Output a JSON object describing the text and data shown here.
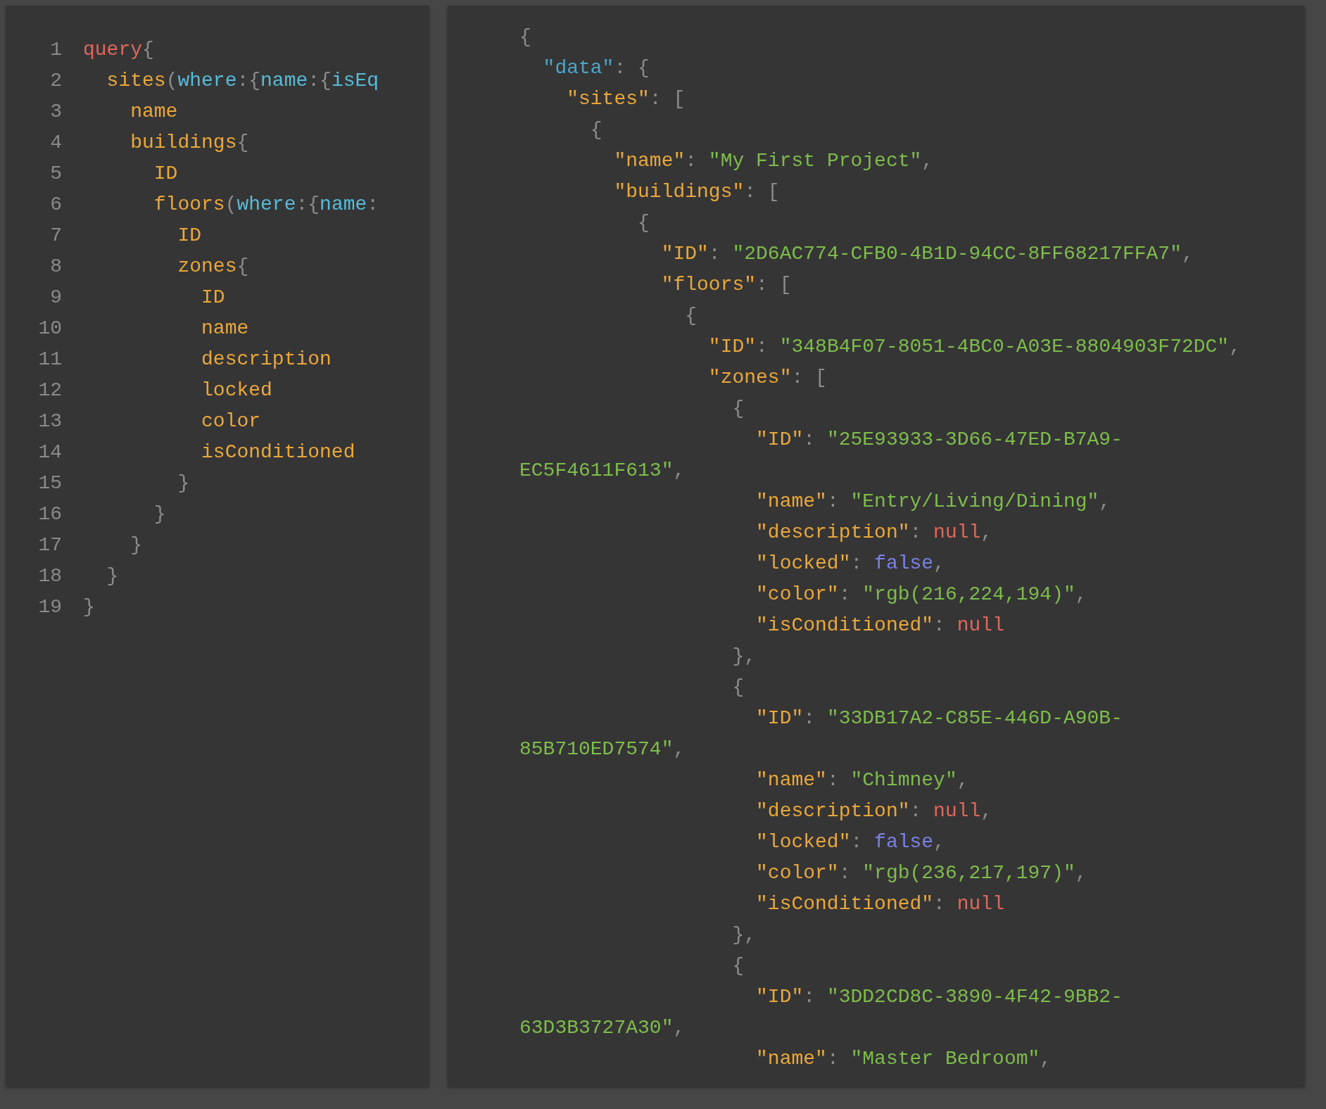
{
  "query_editor": {
    "lines": [
      {
        "number": "1",
        "tokens": [
          {
            "kind": "keyword",
            "text": "query"
          },
          {
            "kind": "punct",
            "text": "{"
          }
        ]
      },
      {
        "number": "2",
        "tokens": [
          {
            "kind": "field",
            "text": "  sites"
          },
          {
            "kind": "punct",
            "text": "("
          },
          {
            "kind": "arg",
            "text": "where"
          },
          {
            "kind": "punct",
            "text": ":{"
          },
          {
            "kind": "arg",
            "text": "name"
          },
          {
            "kind": "punct",
            "text": ":{"
          },
          {
            "kind": "arg",
            "text": "isEq"
          }
        ]
      },
      {
        "number": "3",
        "tokens": [
          {
            "kind": "field",
            "text": "    name"
          }
        ]
      },
      {
        "number": "4",
        "tokens": [
          {
            "kind": "field",
            "text": "    buildings"
          },
          {
            "kind": "punct",
            "text": "{"
          }
        ]
      },
      {
        "number": "5",
        "tokens": [
          {
            "kind": "field",
            "text": "      ID"
          }
        ]
      },
      {
        "number": "6",
        "tokens": [
          {
            "kind": "field",
            "text": "      floors"
          },
          {
            "kind": "punct",
            "text": "("
          },
          {
            "kind": "arg",
            "text": "where"
          },
          {
            "kind": "punct",
            "text": ":{"
          },
          {
            "kind": "arg",
            "text": "name"
          },
          {
            "kind": "punct",
            "text": ":"
          }
        ]
      },
      {
        "number": "7",
        "tokens": [
          {
            "kind": "field",
            "text": "        ID"
          }
        ]
      },
      {
        "number": "8",
        "tokens": [
          {
            "kind": "field",
            "text": "        zones"
          },
          {
            "kind": "punct",
            "text": "{"
          }
        ]
      },
      {
        "number": "9",
        "tokens": [
          {
            "kind": "field",
            "text": "          ID"
          }
        ]
      },
      {
        "number": "10",
        "tokens": [
          {
            "kind": "field",
            "text": "          name"
          }
        ]
      },
      {
        "number": "11",
        "tokens": [
          {
            "kind": "field",
            "text": "          description"
          }
        ]
      },
      {
        "number": "12",
        "tokens": [
          {
            "kind": "field",
            "text": "          locked"
          }
        ]
      },
      {
        "number": "13",
        "tokens": [
          {
            "kind": "field",
            "text": "          color"
          }
        ]
      },
      {
        "number": "14",
        "tokens": [
          {
            "kind": "field",
            "text": "          isConditioned"
          }
        ]
      },
      {
        "number": "15",
        "tokens": [
          {
            "kind": "punct",
            "text": "        }"
          }
        ]
      },
      {
        "number": "16",
        "tokens": [
          {
            "kind": "punct",
            "text": "      }"
          }
        ]
      },
      {
        "number": "17",
        "tokens": [
          {
            "kind": "punct",
            "text": "    }"
          }
        ]
      },
      {
        "number": "18",
        "tokens": [
          {
            "kind": "punct",
            "text": "  }"
          }
        ]
      },
      {
        "number": "19",
        "tokens": [
          {
            "kind": "punct",
            "text": "}"
          }
        ]
      }
    ]
  },
  "result_viewer": {
    "lines": [
      [
        {
          "kind": "punct",
          "text": "{"
        }
      ],
      [
        {
          "kind": "datakey",
          "text": "  \"data\""
        },
        {
          "kind": "punct",
          "text": ": {"
        }
      ],
      [
        {
          "kind": "field",
          "text": "    \"sites\""
        },
        {
          "kind": "punct",
          "text": ": ["
        }
      ],
      [
        {
          "kind": "punct",
          "text": "      {"
        }
      ],
      [
        {
          "kind": "field",
          "text": "        \"name\""
        },
        {
          "kind": "punct",
          "text": ": "
        },
        {
          "kind": "string",
          "text": "\"My First Project\""
        },
        {
          "kind": "punct",
          "text": ","
        }
      ],
      [
        {
          "kind": "field",
          "text": "        \"buildings\""
        },
        {
          "kind": "punct",
          "text": ": ["
        }
      ],
      [
        {
          "kind": "punct",
          "text": "          {"
        }
      ],
      [
        {
          "kind": "field",
          "text": "            \"ID\""
        },
        {
          "kind": "punct",
          "text": ": "
        },
        {
          "kind": "string",
          "text": "\"2D6AC774-CFB0-4B1D-94CC-8FF68217FFA7\""
        },
        {
          "kind": "punct",
          "text": ","
        }
      ],
      [
        {
          "kind": "field",
          "text": "            \"floors\""
        },
        {
          "kind": "punct",
          "text": ": ["
        }
      ],
      [
        {
          "kind": "punct",
          "text": "              {"
        }
      ],
      [
        {
          "kind": "field",
          "text": "                \"ID\""
        },
        {
          "kind": "punct",
          "text": ": "
        },
        {
          "kind": "string",
          "text": "\"348B4F07-8051-4BC0-A03E-8804903F72DC\""
        },
        {
          "kind": "punct",
          "text": ","
        }
      ],
      [
        {
          "kind": "field",
          "text": "                \"zones\""
        },
        {
          "kind": "punct",
          "text": ": ["
        }
      ],
      [
        {
          "kind": "punct",
          "text": "                  {"
        }
      ],
      [
        {
          "kind": "field",
          "text": "                    \"ID\""
        },
        {
          "kind": "punct",
          "text": ": "
        },
        {
          "kind": "string",
          "text": "\"25E93933-3D66-47ED-B7A9-"
        }
      ],
      [
        {
          "kind": "string",
          "text": "EC5F4611F613\""
        },
        {
          "kind": "punct",
          "text": ","
        }
      ],
      [
        {
          "kind": "field",
          "text": "                    \"name\""
        },
        {
          "kind": "punct",
          "text": ": "
        },
        {
          "kind": "string",
          "text": "\"Entry/Living/Dining\""
        },
        {
          "kind": "punct",
          "text": ","
        }
      ],
      [
        {
          "kind": "field",
          "text": "                    \"description\""
        },
        {
          "kind": "punct",
          "text": ": "
        },
        {
          "kind": "null",
          "text": "null"
        },
        {
          "kind": "punct",
          "text": ","
        }
      ],
      [
        {
          "kind": "field",
          "text": "                    \"locked\""
        },
        {
          "kind": "punct",
          "text": ": "
        },
        {
          "kind": "bool",
          "text": "false"
        },
        {
          "kind": "punct",
          "text": ","
        }
      ],
      [
        {
          "kind": "field",
          "text": "                    \"color\""
        },
        {
          "kind": "punct",
          "text": ": "
        },
        {
          "kind": "string",
          "text": "\"rgb(216,224,194)\""
        },
        {
          "kind": "punct",
          "text": ","
        }
      ],
      [
        {
          "kind": "field",
          "text": "                    \"isConditioned\""
        },
        {
          "kind": "punct",
          "text": ": "
        },
        {
          "kind": "null",
          "text": "null"
        }
      ],
      [
        {
          "kind": "punct",
          "text": "                  },"
        }
      ],
      [
        {
          "kind": "punct",
          "text": "                  {"
        }
      ],
      [
        {
          "kind": "field",
          "text": "                    \"ID\""
        },
        {
          "kind": "punct",
          "text": ": "
        },
        {
          "kind": "string",
          "text": "\"33DB17A2-C85E-446D-A90B-"
        }
      ],
      [
        {
          "kind": "string",
          "text": "85B710ED7574\""
        },
        {
          "kind": "punct",
          "text": ","
        }
      ],
      [
        {
          "kind": "field",
          "text": "                    \"name\""
        },
        {
          "kind": "punct",
          "text": ": "
        },
        {
          "kind": "string",
          "text": "\"Chimney\""
        },
        {
          "kind": "punct",
          "text": ","
        }
      ],
      [
        {
          "kind": "field",
          "text": "                    \"description\""
        },
        {
          "kind": "punct",
          "text": ": "
        },
        {
          "kind": "null",
          "text": "null"
        },
        {
          "kind": "punct",
          "text": ","
        }
      ],
      [
        {
          "kind": "field",
          "text": "                    \"locked\""
        },
        {
          "kind": "punct",
          "text": ": "
        },
        {
          "kind": "bool",
          "text": "false"
        },
        {
          "kind": "punct",
          "text": ","
        }
      ],
      [
        {
          "kind": "field",
          "text": "                    \"color\""
        },
        {
          "kind": "punct",
          "text": ": "
        },
        {
          "kind": "string",
          "text": "\"rgb(236,217,197)\""
        },
        {
          "kind": "punct",
          "text": ","
        }
      ],
      [
        {
          "kind": "field",
          "text": "                    \"isConditioned\""
        },
        {
          "kind": "punct",
          "text": ": "
        },
        {
          "kind": "null",
          "text": "null"
        }
      ],
      [
        {
          "kind": "punct",
          "text": "                  },"
        }
      ],
      [
        {
          "kind": "punct",
          "text": "                  {"
        }
      ],
      [
        {
          "kind": "field",
          "text": "                    \"ID\""
        },
        {
          "kind": "punct",
          "text": ": "
        },
        {
          "kind": "string",
          "text": "\"3DD2CD8C-3890-4F42-9BB2-"
        }
      ],
      [
        {
          "kind": "string",
          "text": "63D3B3727A30\""
        },
        {
          "kind": "punct",
          "text": ","
        }
      ],
      [
        {
          "kind": "field",
          "text": "                    \"name\""
        },
        {
          "kind": "punct",
          "text": ": "
        },
        {
          "kind": "string",
          "text": "\"Master Bedroom\""
        },
        {
          "kind": "punct",
          "text": ","
        }
      ]
    ]
  }
}
